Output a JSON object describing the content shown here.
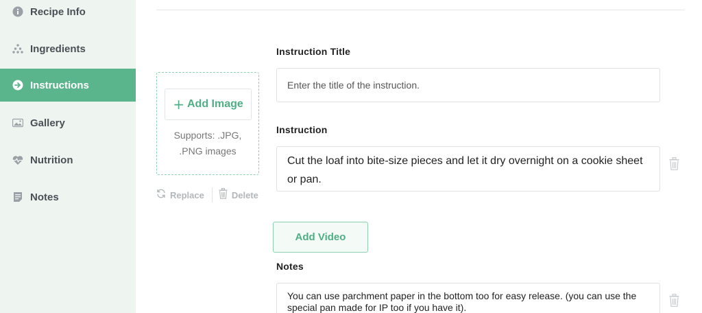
{
  "sidebar": {
    "items": [
      {
        "label": "Recipe Info",
        "icon": "info-icon"
      },
      {
        "label": "Ingredients",
        "icon": "ingredients-dots-icon"
      },
      {
        "label": "Instructions",
        "icon": "arrow-circle-icon",
        "active": true
      },
      {
        "label": "Gallery",
        "icon": "image-icon"
      },
      {
        "label": "Nutrition",
        "icon": "heartbeat-icon"
      },
      {
        "label": "Notes",
        "icon": "notes-icon"
      }
    ]
  },
  "image_upload": {
    "add_label": "Add Image",
    "supports_line1": "Supports: .JPG,",
    "supports_line2": ".PNG images",
    "replace_label": "Replace",
    "delete_label": "Delete"
  },
  "instruction_title": {
    "label": "Instruction Title",
    "placeholder": "Enter the title of the instruction."
  },
  "instruction": {
    "label": "Instruction",
    "value": "Cut the loaf into bite-size pieces and let it dry overnight on a cookie sheet or pan."
  },
  "video": {
    "add_label": "Add Video"
  },
  "notes": {
    "label": "Notes",
    "value": "You can use parchment paper in the bottom too for easy release. (you can use the special pan made for IP too if you have it)."
  },
  "colors": {
    "accent": "#5bb58c",
    "accent_text": "#4fae85",
    "sidebar_bg": "#eef5f1"
  }
}
